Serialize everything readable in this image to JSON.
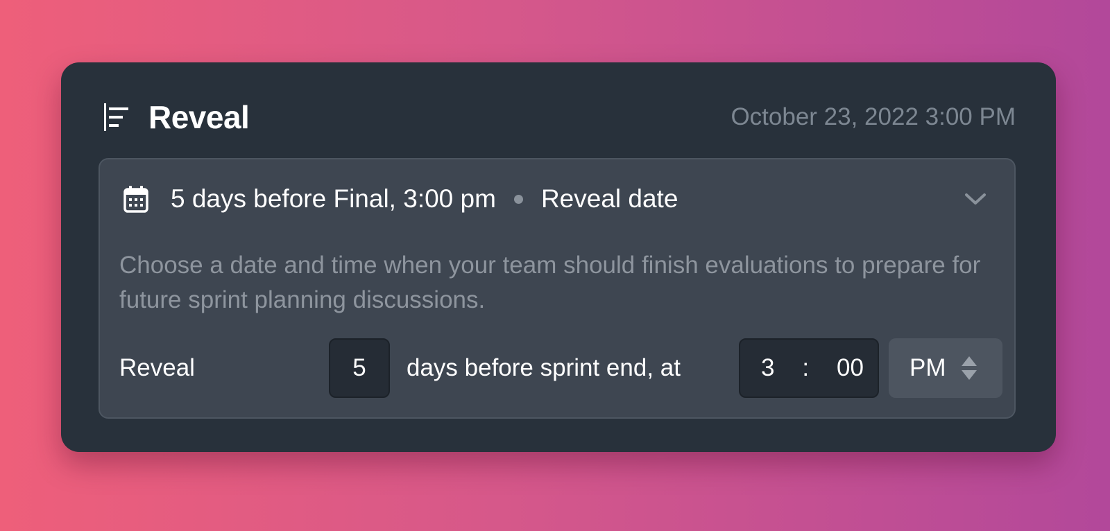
{
  "card": {
    "title": "Reveal",
    "date": "October 23, 2022 3:00 PM",
    "title_icon": "timeline-icon"
  },
  "panel": {
    "calendar_icon": "calendar-icon",
    "summary": "5 days before Final, 3:00 pm",
    "summary_tag": "Reveal date",
    "chevron_icon": "chevron-down-icon",
    "description": "Choose a date and time when your team should finish evaluations to prepare for future sprint planning discussions.",
    "controls": {
      "label": "Reveal",
      "days_value": "5",
      "days_suffix": "days before sprint end, at",
      "hour": "3",
      "separator": ":",
      "minute": "00",
      "ampm": "PM",
      "ampm_icon": "up-down-stepper-icon"
    }
  },
  "colors": {
    "card_bg": "#28313b",
    "panel_bg": "#3e4651",
    "input_bg": "#252c35",
    "muted_text": "#8e959e",
    "gradient_start": "#ee5f7a",
    "gradient_end": "#b2489a"
  }
}
